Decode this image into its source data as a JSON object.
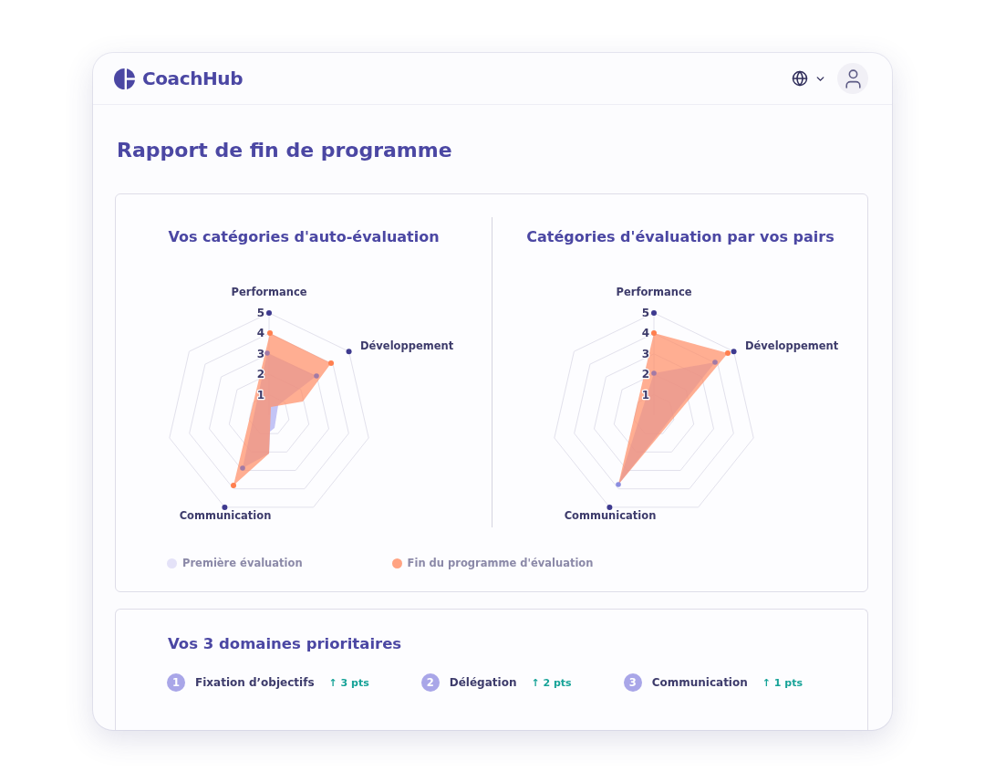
{
  "header": {
    "logo_text": "CoachHub"
  },
  "title": "Rapport de fin de programme",
  "charts": [
    {
      "title": "Vos catégories d'auto-évaluation",
      "axes": [
        "Performance",
        "Développement",
        "Communication"
      ],
      "ticks": [
        "5",
        "4",
        "3",
        "2",
        "1"
      ]
    },
    {
      "title": "Catégories d'évaluation par vos pairs",
      "axes": [
        "Performance",
        "Développement",
        "Communication"
      ],
      "ticks": [
        "5",
        "4",
        "3",
        "2",
        "1"
      ]
    }
  ],
  "legend": [
    {
      "label": "Première évaluation",
      "color": "#e4e2f8"
    },
    {
      "label": "Fin du programme d'évaluation",
      "color": "#ffa382"
    }
  ],
  "priorities": {
    "title": "Vos 3 domaines prioritaires",
    "items": [
      {
        "number": "1",
        "label": "Fixation d’objectifs",
        "delta": "↑ 3 pts"
      },
      {
        "number": "2",
        "label": "Délégation",
        "delta": "↑ 2 pts"
      },
      {
        "number": "3",
        "label": "Communication",
        "delta": "↑ 1 pts"
      }
    ]
  }
}
